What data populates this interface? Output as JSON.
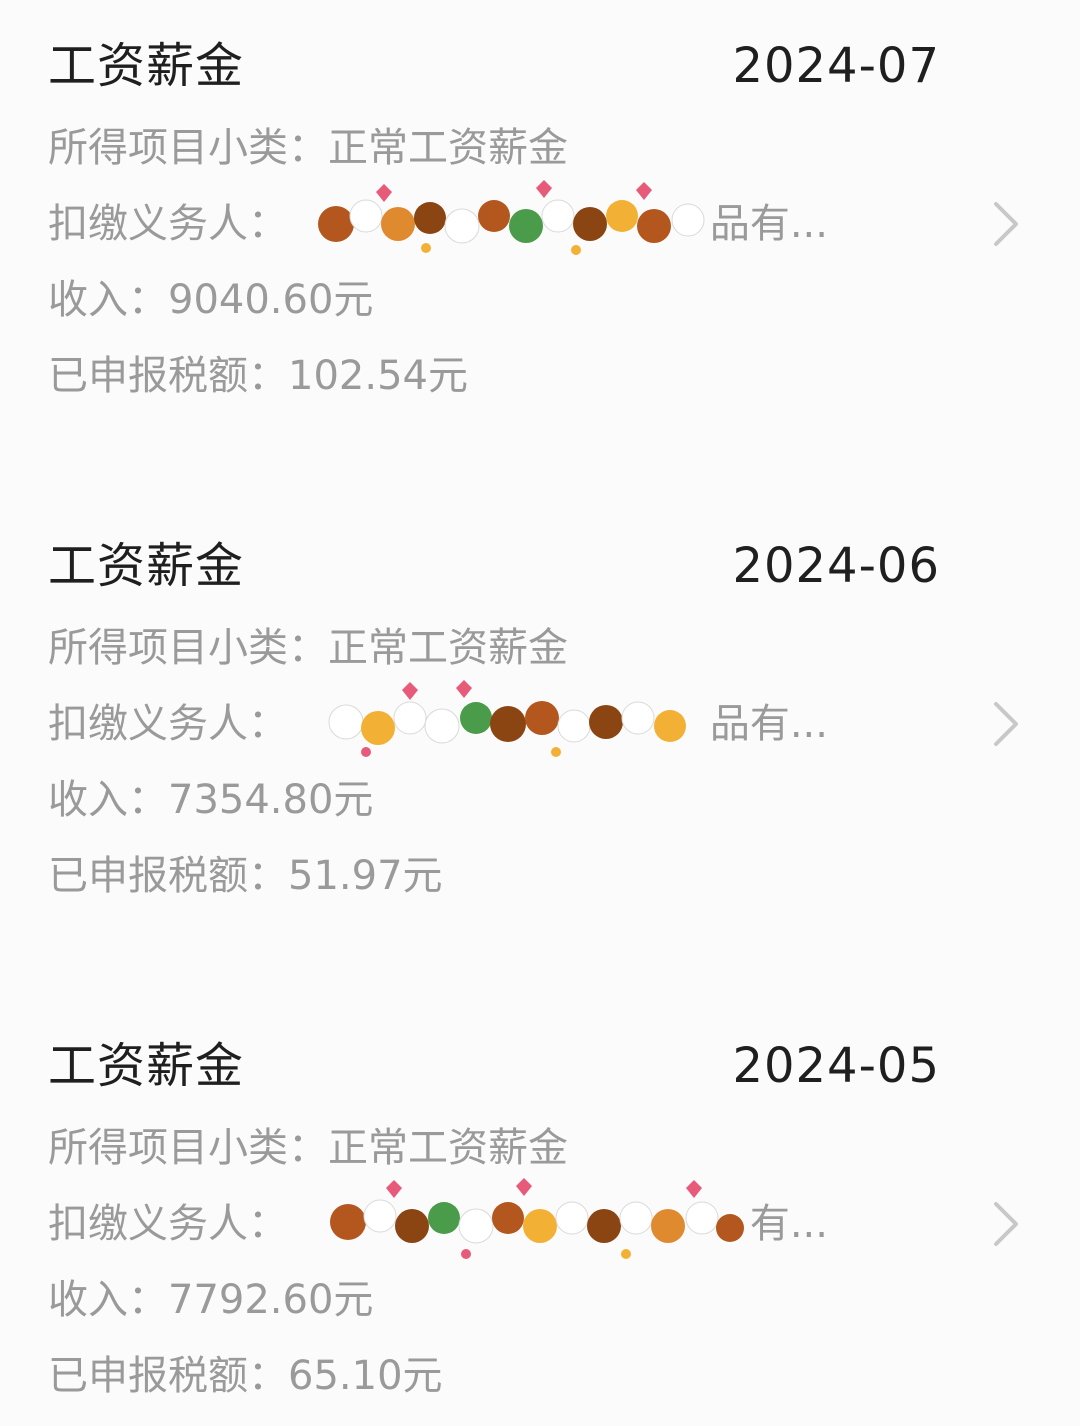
{
  "records": [
    {
      "title": "工资薪金",
      "period": "2024-07",
      "category_label": "所得项目小类：",
      "category_value": "正常工资薪金",
      "withholder_label": "扣缴义务人：",
      "withholder_value_visible": "品有...",
      "income_label": "收入：",
      "income_value": "9040.60元",
      "tax_label": "已申报税额：",
      "tax_value": "102.54元"
    },
    {
      "title": "工资薪金",
      "period": "2024-06",
      "category_label": "所得项目小类：",
      "category_value": "正常工资薪金",
      "withholder_label": "扣缴义务人：",
      "withholder_value_visible": "品有...",
      "income_label": "收入：",
      "income_value": "7354.80元",
      "tax_label": "已申报税额：",
      "tax_value": "51.97元"
    },
    {
      "title": "工资薪金",
      "period": "2024-05",
      "category_label": "所得项目小类：",
      "category_value": "正常工资薪金",
      "withholder_label": "扣缴义务人：",
      "withholder_value_visible": "有...",
      "income_label": "收入：",
      "income_value": "7792.60元",
      "tax_label": "已申报税额：",
      "tax_value": "65.10元"
    }
  ],
  "icons": {
    "chevron": "chevron-right-icon",
    "redaction": "sticker-redaction"
  },
  "colors": {
    "background": "#fbfbfb",
    "title_text": "#1f1f1f",
    "detail_text": "#9a9a9a",
    "chevron": "#c8c8c8"
  }
}
